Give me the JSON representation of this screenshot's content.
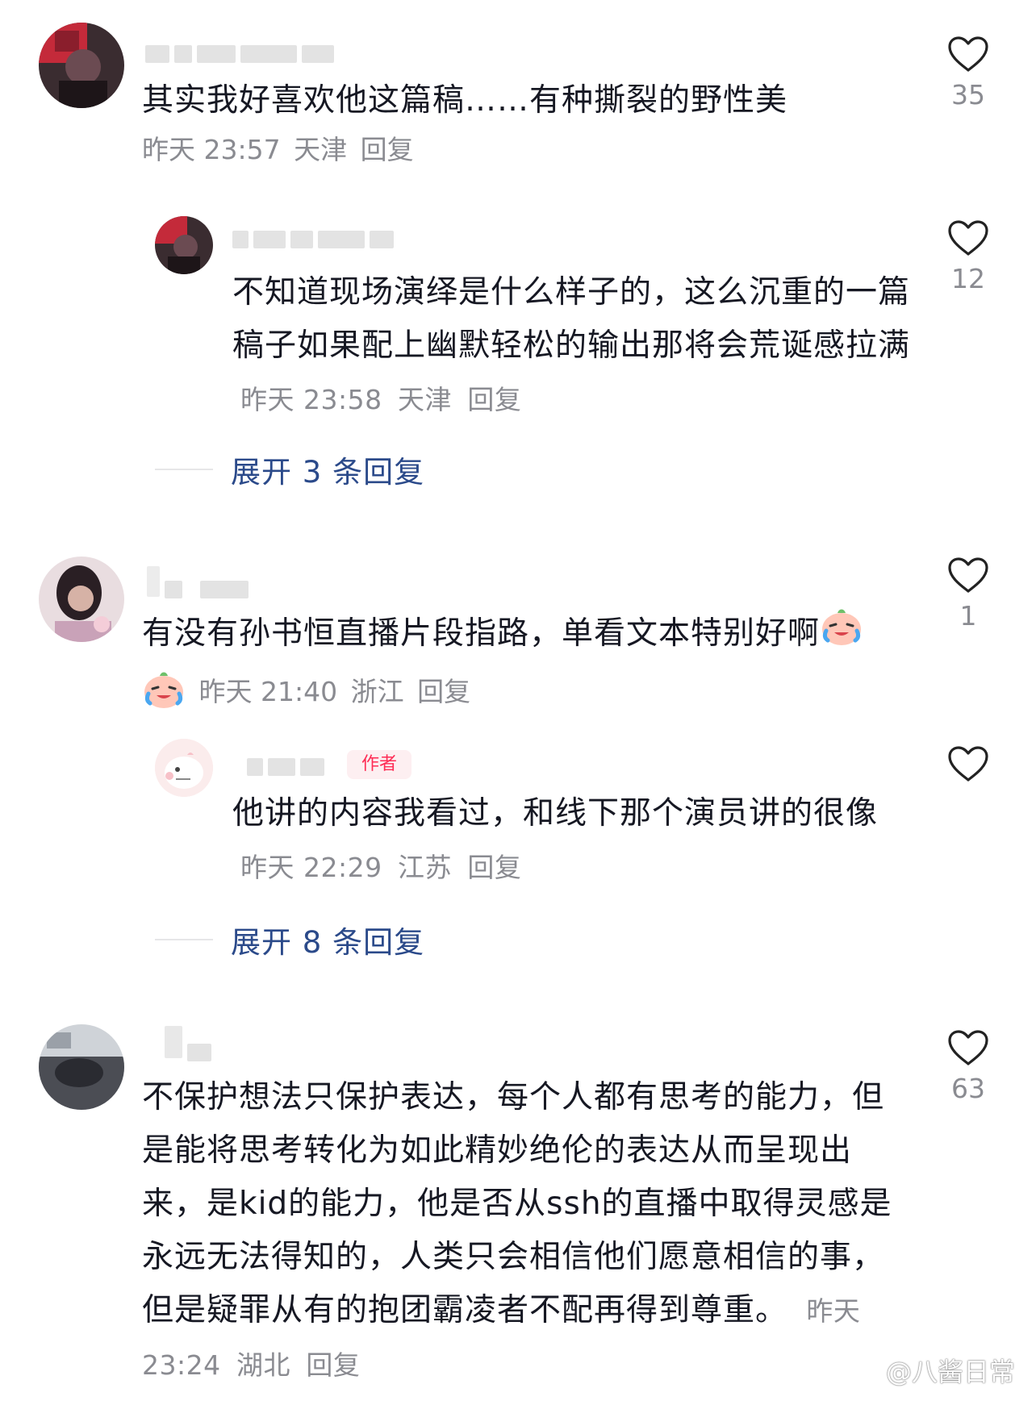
{
  "comments": [
    {
      "text": "其实我好喜欢他这篇稿……有种撕裂的野性美",
      "time": "昨天 23:57",
      "location": "天津",
      "reply_label": "回复",
      "likes": "35",
      "sub_reply": {
        "text": "不知道现场演绎是什么样子的，这么沉重的一篇稿子如果配上幽默轻松的输出那将会荒诞感拉满",
        "time": "昨天 23:58",
        "location": "天津",
        "reply_label": "回复",
        "likes": "12"
      },
      "expand_label": "展开 3 条回复"
    },
    {
      "text": "有没有孙书恒直播片段指路，单看文本特别好啊",
      "time": "昨天 21:40",
      "location": "浙江",
      "reply_label": "回复",
      "likes": "1",
      "sub_reply": {
        "author_tag": "作者",
        "text": "他讲的内容我看过，和线下那个演员讲的很像",
        "time": "昨天 22:29",
        "location": "江苏",
        "reply_label": "回复",
        "likes": ""
      },
      "expand_label": "展开 8 条回复"
    },
    {
      "text": "不保护想法只保护表达，每个人都有思考的能力，但是能将思考转化为如此精妙绝伦的表达从而呈现出来，是kid的能力，他是否从ssh的直播中取得灵感是永远无法得知的，人类只会相信他们愿意相信的事，但是疑罪从有的抱团霸凌者不配再得到尊重。",
      "time": "昨天 23:24",
      "location": "湖北",
      "reply_label": "回复",
      "likes": "63"
    }
  ],
  "watermark": "@八酱日常",
  "icons": {
    "like": "heart-outline-icon",
    "emoji": "crying-laughing-emoji",
    "watermark": "weibo-logo-icon"
  },
  "colors": {
    "text": "#161823",
    "meta": "#8a8b91",
    "link": "#2b4a8a",
    "author_tag": "#fe2c55"
  }
}
